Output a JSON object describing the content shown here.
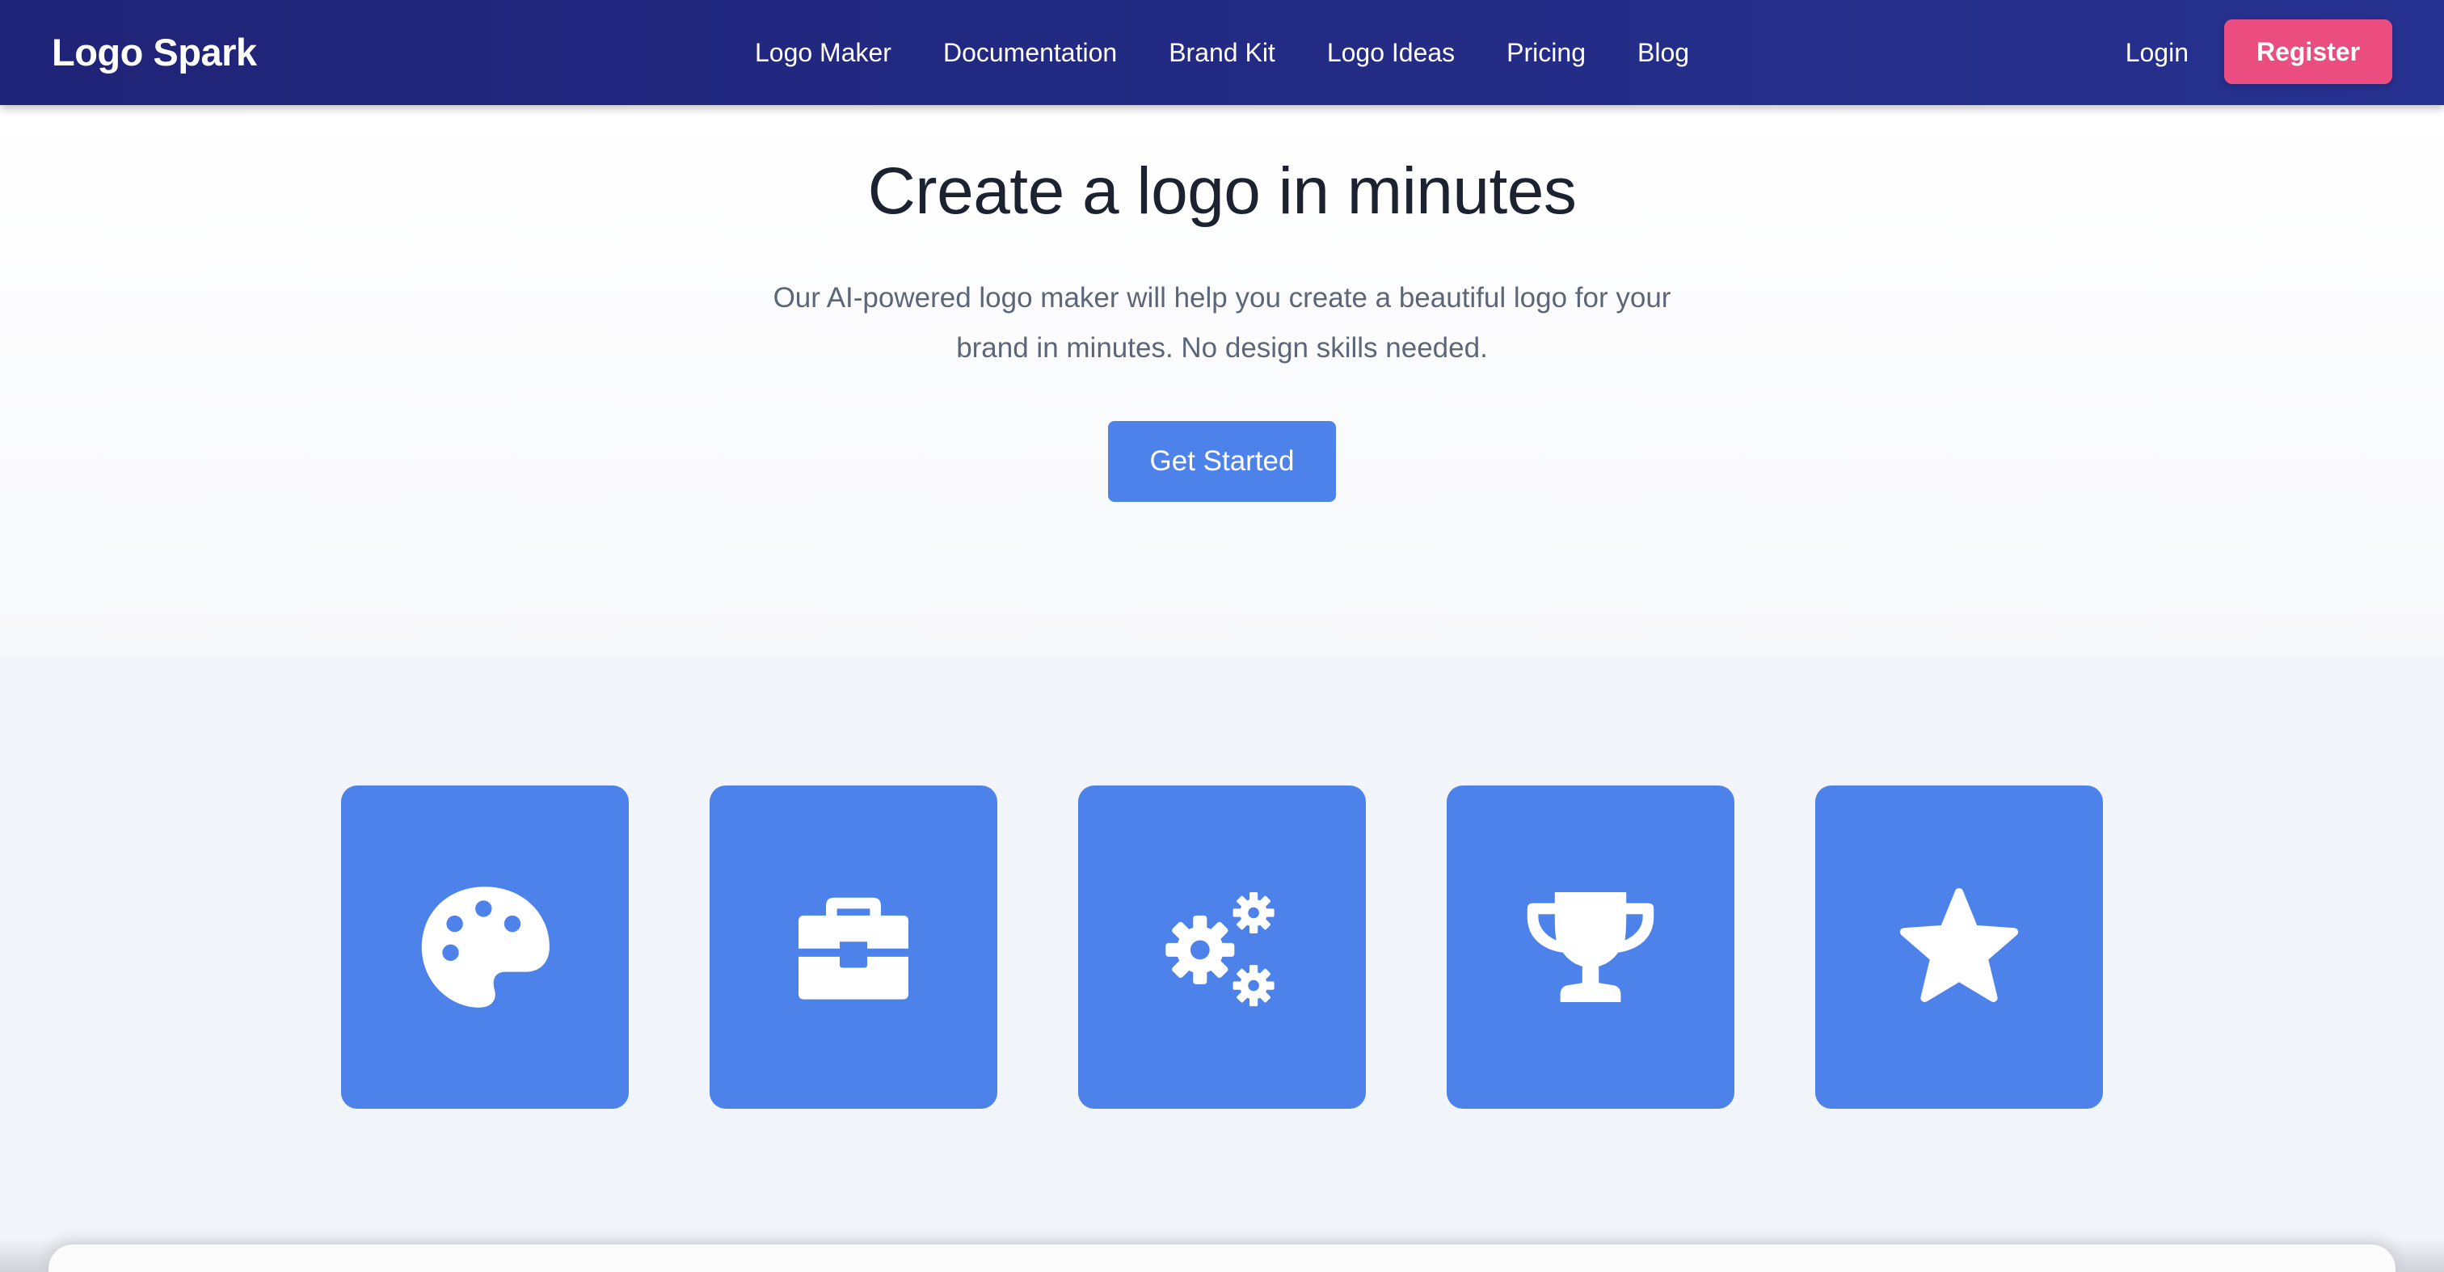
{
  "navbar": {
    "brand": "Logo Spark",
    "links": [
      "Logo Maker",
      "Documentation",
      "Brand Kit",
      "Logo Ideas",
      "Pricing",
      "Blog"
    ],
    "login_label": "Login",
    "register_label": "Register"
  },
  "hero": {
    "title": "Create a logo in minutes",
    "subtitle_line1": "Our AI-powered logo maker will help you create a beautiful logo for your",
    "subtitle_line2": "brand in minutes. No design skills needed.",
    "cta_label": "Get Started"
  },
  "features": {
    "icons": [
      "palette-icon",
      "toolbox-icon",
      "gears-icon",
      "trophy-icon",
      "star-icon"
    ]
  },
  "colors": {
    "nav_bg": "#1f2478",
    "accent": "#4d82ea",
    "register": "#ec4d81",
    "title_text": "#1c2230",
    "subtitle_text": "#5d6678"
  }
}
